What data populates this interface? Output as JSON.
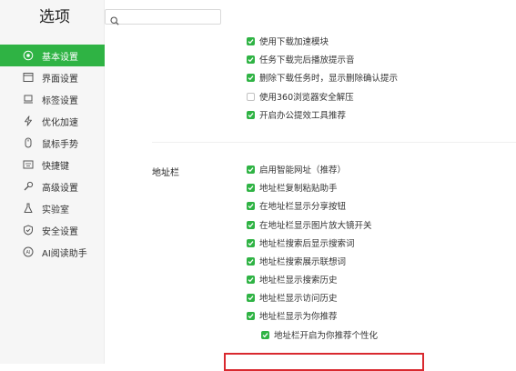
{
  "window": {
    "title": "选项"
  },
  "search": {
    "placeholder": "",
    "value": ""
  },
  "colors": {
    "accent": "#2fb344",
    "highlight_border": "#d9292f"
  },
  "sidebar": {
    "items": [
      {
        "label": "基本设置",
        "icon": "target-icon",
        "active": true
      },
      {
        "label": "界面设置",
        "icon": "window-icon",
        "active": false
      },
      {
        "label": "标签设置",
        "icon": "tab-icon",
        "active": false
      },
      {
        "label": "优化加速",
        "icon": "lightning-icon",
        "active": false
      },
      {
        "label": "鼠标手势",
        "icon": "mouse-icon",
        "active": false
      },
      {
        "label": "快捷键",
        "icon": "keyboard-icon",
        "active": false
      },
      {
        "label": "高级设置",
        "icon": "wrench-icon",
        "active": false
      },
      {
        "label": "实验室",
        "icon": "flask-icon",
        "active": false
      },
      {
        "label": "安全设置",
        "icon": "shield-icon",
        "active": false
      },
      {
        "label": "AI阅读助手",
        "icon": "ai-icon",
        "active": false
      }
    ]
  },
  "download_options": [
    {
      "label": "使用下载加速模块",
      "checked": true
    },
    {
      "label": "任务下载完后播放提示音",
      "checked": true
    },
    {
      "label": "删除下载任务时，显示删除确认提示",
      "checked": true
    },
    {
      "label": "使用360浏览器安全解压",
      "checked": false
    },
    {
      "label": "开启办公提效工具推荐",
      "checked": true
    }
  ],
  "address_bar": {
    "section_label": "地址栏",
    "options": [
      {
        "label": "启用智能网址（推荐）",
        "checked": true
      },
      {
        "label": "地址栏复制粘贴助手",
        "checked": true
      },
      {
        "label": "在地址栏显示分享按钮",
        "checked": true
      },
      {
        "label": "在地址栏显示图片放大镜开关",
        "checked": true
      },
      {
        "label": "地址栏搜索后显示搜索词",
        "checked": true
      },
      {
        "label": "地址栏搜索展示联想词",
        "checked": true
      },
      {
        "label": "地址栏显示搜索历史",
        "checked": true
      },
      {
        "label": "地址栏显示访问历史",
        "checked": true
      },
      {
        "label": "地址栏显示为你推荐",
        "checked": true
      }
    ],
    "sub_option": {
      "label": "地址栏开启为你推荐个性化",
      "checked": true
    }
  }
}
